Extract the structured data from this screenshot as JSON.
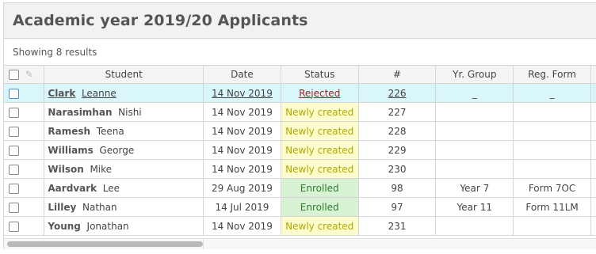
{
  "page": {
    "title": "Academic year 2019/20 Applicants",
    "results_text": "Showing 8 results"
  },
  "columns": [
    "Student",
    "Date",
    "Status",
    "#",
    "Yr. Group",
    "Reg. Form"
  ],
  "rows": [
    {
      "surname": "Clark",
      "firstname": "Leanne",
      "date": "14 Nov 2019",
      "status": "Rejected",
      "num": "226",
      "yr": "_",
      "form": "_"
    },
    {
      "surname": "Narasimhan",
      "firstname": "Nishi",
      "date": "14 Nov 2019",
      "status": "Newly created",
      "num": "227",
      "yr": "",
      "form": ""
    },
    {
      "surname": "Ramesh",
      "firstname": "Teena",
      "date": "14 Nov 2019",
      "status": "Newly created",
      "num": "228",
      "yr": "",
      "form": ""
    },
    {
      "surname": "Williams",
      "firstname": "George",
      "date": "14 Nov 2019",
      "status": "Newly created",
      "num": "229",
      "yr": "",
      "form": ""
    },
    {
      "surname": "Wilson",
      "firstname": "Mike",
      "date": "14 Nov 2019",
      "status": "Newly created",
      "num": "230",
      "yr": "",
      "form": ""
    },
    {
      "surname": "Aardvark",
      "firstname": "Lee",
      "date": "29 Aug 2019",
      "status": "Enrolled",
      "num": "98",
      "yr": "Year 7",
      "form": "Form 7OC"
    },
    {
      "surname": "Lilley",
      "firstname": "Nathan",
      "date": "14 Jul 2019",
      "status": "Enrolled",
      "num": "97",
      "yr": "Year 11",
      "form": "Form 11LM"
    },
    {
      "surname": "Young",
      "firstname": "Jonathan",
      "date": "14 Nov 2019",
      "status": "Newly created",
      "num": "231",
      "yr": "",
      "form": ""
    }
  ],
  "icons": {
    "header_checkbox": "checkbox-icon",
    "edit": "pencil-icon"
  },
  "colors": {
    "rejected": "#a02020",
    "newly_created_bg": "#fcfccc",
    "enrolled_bg": "#d8f2d4",
    "selected_row_bg": "#d9f7fb"
  }
}
